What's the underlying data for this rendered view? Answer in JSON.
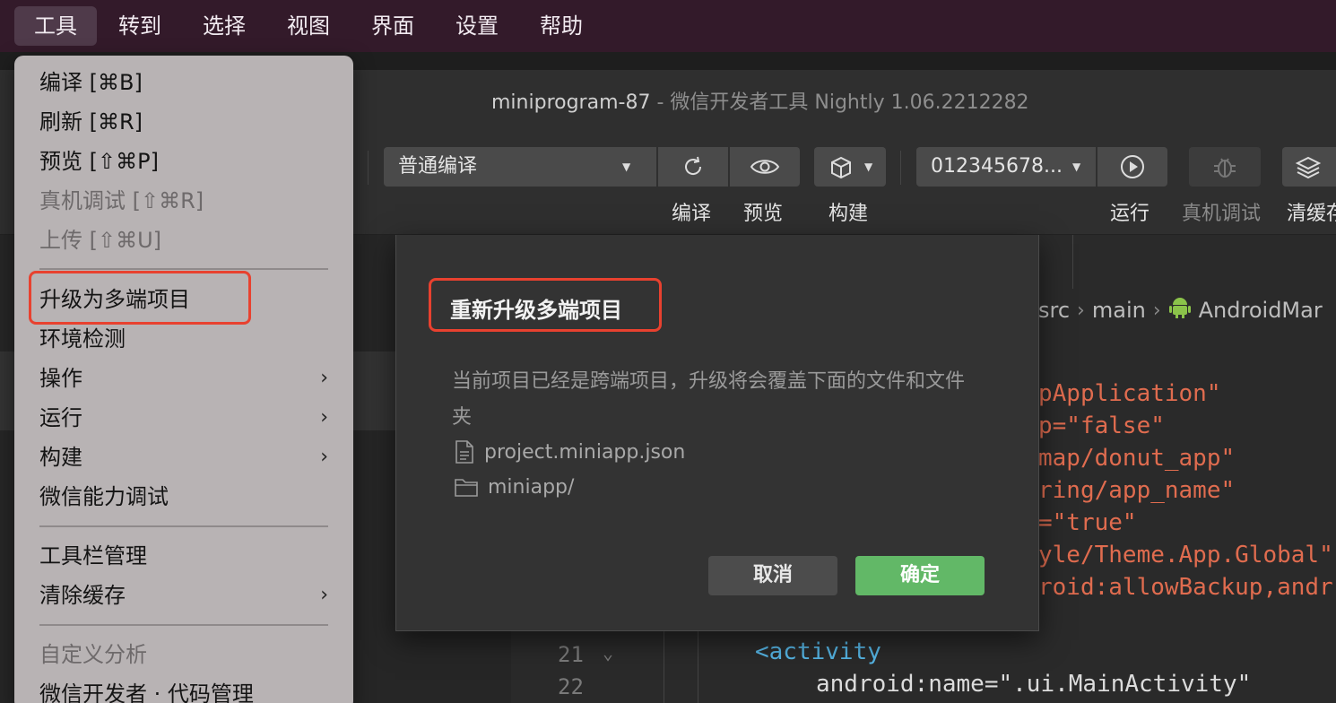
{
  "menubar": {
    "edge_glyph": "",
    "menus": [
      "工具",
      "转到",
      "选择",
      "视图",
      "界面",
      "设置",
      "帮助"
    ],
    "active_index": 0
  },
  "window": {
    "title": "miniprogram-87",
    "subtitle": " - 微信开发者工具 Nightly 1.06.2212282"
  },
  "toolbar": {
    "compile_mode": "普通编译",
    "device_select": "012345678...",
    "labels": {
      "compile": "编译",
      "preview": "预览",
      "build": "构建",
      "run": "运行",
      "remote_debug": "真机调试",
      "clear_cache": "清缓存"
    }
  },
  "dropdown": {
    "items": [
      {
        "label": "编译 [⌘B]",
        "enabled": true
      },
      {
        "label": "刷新 [⌘R]",
        "enabled": true
      },
      {
        "label": "预览 [⇧⌘P]",
        "enabled": true
      },
      {
        "label": "真机调试 [⇧⌘R]",
        "enabled": false
      },
      {
        "label": "上传 [⇧⌘U]",
        "enabled": false
      },
      {
        "label": "升级为多端项目",
        "enabled": true,
        "highlighted": true
      },
      {
        "label": "环境检测",
        "enabled": true
      },
      {
        "label": "操作",
        "enabled": true,
        "submenu": true
      },
      {
        "label": "运行",
        "enabled": true,
        "submenu": true
      },
      {
        "label": "构建",
        "enabled": true,
        "submenu": true
      },
      {
        "label": "微信能力调试",
        "enabled": true
      },
      {
        "label": "工具栏管理",
        "enabled": true
      },
      {
        "label": "清除缓存",
        "enabled": true,
        "submenu": true
      },
      {
        "label": "自定义分析",
        "enabled": false
      },
      {
        "label": "微信开发者 · 代码管理",
        "enabled": true
      }
    ],
    "submenu_arrow": "›"
  },
  "dialog": {
    "title": "重新升级多端项目",
    "description": "当前项目已经是跨端项目，升级将会覆盖下面的文件和文件夹",
    "files": [
      {
        "name": "project.miniapp.json",
        "icon": "file-icon"
      },
      {
        "name": "miniapp/",
        "icon": "folder-icon"
      }
    ],
    "cancel_label": "取消",
    "confirm_label": "确定"
  },
  "editor": {
    "breadcrumb": [
      "src",
      "main",
      "AndroidMar"
    ],
    "line_numbers": [
      "21",
      "22"
    ],
    "code_lines": [
      {
        "text": "pApplication\""
      },
      {
        "text": "p=\"false\""
      },
      {
        "text": "map/donut_app\""
      },
      {
        "text": "ring/app_name\""
      },
      {
        "text": "=\"true\""
      },
      {
        "text": "yle/Theme.App.Global\""
      },
      {
        "text": "roid:allowBackup,andr"
      },
      {
        "text": "<activity"
      },
      {
        "text": "android:name=\".ui.MainActivity\""
      }
    ]
  },
  "colors": {
    "accent_green": "#62b867",
    "highlight_red": "#e8412f",
    "menubar_bg": "#331a2a"
  }
}
